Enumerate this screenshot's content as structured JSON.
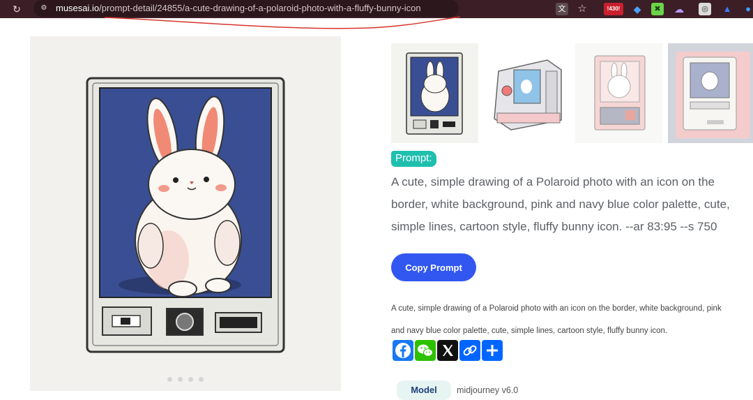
{
  "browser": {
    "url_host": "musesai.io",
    "url_path": "/prompt-detail/24855/a-cute-drawing-of-a-polaroid-photo-with-a-fluffy-bunny-icon",
    "extension_badge": "!430!"
  },
  "gallery": {
    "image_count": 4,
    "active_index": 0
  },
  "prompt": {
    "badge_label": "Prompt:",
    "text": "A cute, simple drawing of a Polaroid photo with an icon on the border, white background, pink and navy blue color palette, cute, simple lines, cartoon style, fluffy bunny icon. --ar 83:95 --s 750",
    "copy_label": "Copy Prompt"
  },
  "description": {
    "line1": "A cute, simple drawing of a Polaroid photo with an icon on the border, white background, pink",
    "line2": "and navy blue color palette, cute, simple lines, cartoon style, fluffy bunny icon."
  },
  "share": {
    "buttons": [
      "facebook-icon",
      "wechat-icon",
      "x-icon",
      "copy-link-icon",
      "more-share-icon"
    ]
  },
  "meta": {
    "model_label": "Model",
    "model_value": "midjourney v6.0"
  },
  "colors": {
    "brand_blue": "#3257f0",
    "prompt_teal": "#1fbfae",
    "navy": "#3a4f93",
    "pink": "#f0a7a0"
  }
}
